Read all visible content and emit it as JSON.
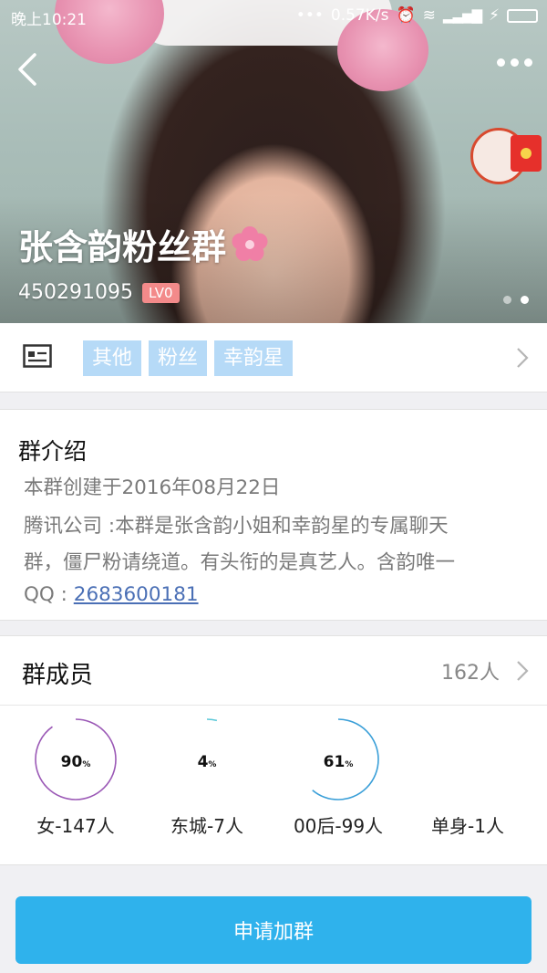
{
  "status_bar": {
    "time": "晚上10:21",
    "network_speed": "0.57K/s"
  },
  "header": {
    "group_name": "张含韵粉丝群",
    "group_number": "450291095",
    "level_badge": "LV0",
    "carousel": {
      "count": 2,
      "active": 2
    }
  },
  "tags": {
    "items": [
      "其他",
      "粉丝",
      "幸韵星"
    ]
  },
  "intro": {
    "title": "群介绍",
    "created": "本群创建于2016年08月22日",
    "desc_line1": "腾讯公司 :本群是张含韵小姐和幸韵星的专属聊天",
    "desc_line2": "群，僵尸粉请绕道。有头衔的是真艺人。含韵唯一",
    "qq_label": "QQ : ",
    "qq_number": "2683600181"
  },
  "members": {
    "title": "群成员",
    "count": "162人",
    "stats": [
      {
        "percent": 90,
        "label": "90",
        "unit": "%",
        "caption": "女-147人",
        "color": "#9b59b6"
      },
      {
        "percent": 4,
        "label": "4",
        "unit": "%",
        "caption": "东城-7人",
        "color": "#5bc8d8"
      },
      {
        "percent": 61,
        "label": "61",
        "unit": "%",
        "caption": "00后-99人",
        "color": "#3a9fd8"
      },
      {
        "percent": null,
        "label": "",
        "unit": "",
        "caption": "单身-1人",
        "color": "#3a9fd8"
      }
    ]
  },
  "actions": {
    "join_label": "申请加群"
  },
  "colors": {
    "accent": "#2fb2ec",
    "tag_bg": "#b6daf7",
    "level_badge": "#f38a8a",
    "link": "#4a6fb5"
  },
  "icons": [
    "back-arrow-icon",
    "more-icon",
    "red-packet-icon",
    "flower-icon",
    "profile-card-icon",
    "chevron-right-icon"
  ]
}
